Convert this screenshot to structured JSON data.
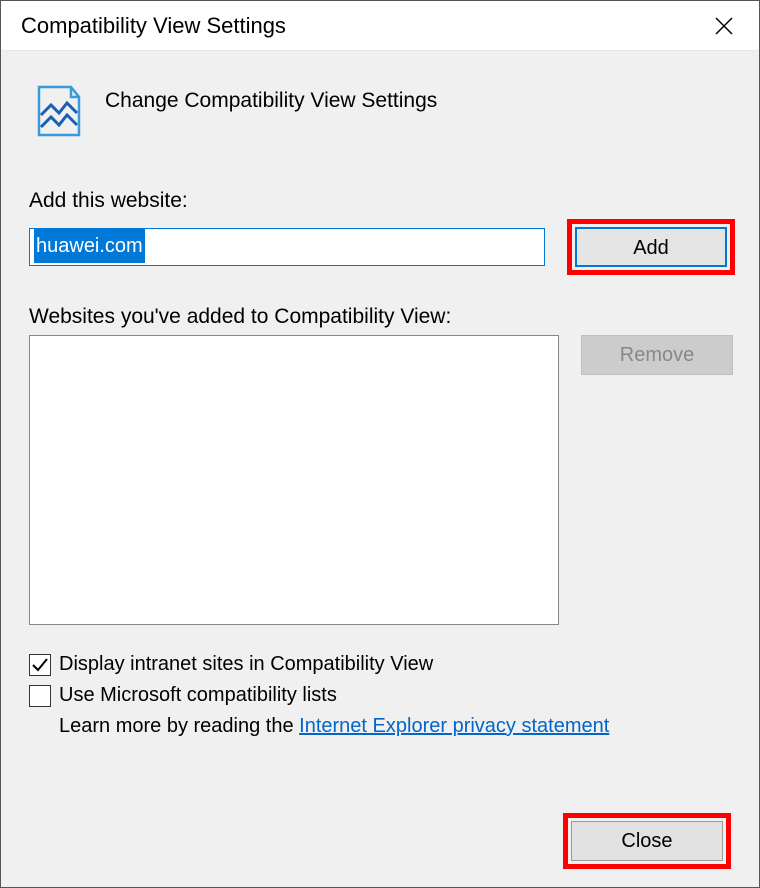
{
  "window": {
    "title": "Compatibility View Settings"
  },
  "header": {
    "title": "Change Compatibility View Settings"
  },
  "addWebsite": {
    "label": "Add this website:",
    "value": "huawei.com",
    "addButton": "Add"
  },
  "websitesList": {
    "label": "Websites you've added to Compatibility View:",
    "removeButton": "Remove"
  },
  "options": {
    "displayIntranet": {
      "label": "Display intranet sites in Compatibility View",
      "checked": true
    },
    "useMsLists": {
      "label": "Use Microsoft compatibility lists",
      "checked": false
    },
    "learnMorePrefix": "Learn more by reading the ",
    "learnMoreLink": "Internet Explorer privacy statement"
  },
  "footer": {
    "closeButton": "Close"
  }
}
